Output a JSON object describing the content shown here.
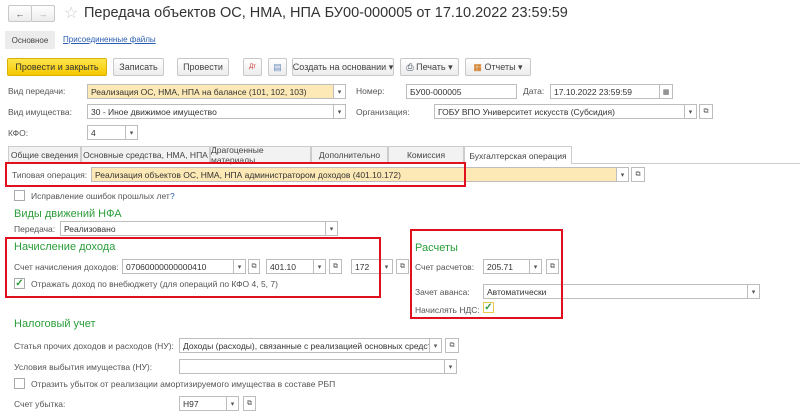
{
  "window": {
    "title": "Передача объектов ОС, НМА, НПА БУ00-000005 от 17.10.2022 23:59:59"
  },
  "nav": {
    "tabs": [
      {
        "label": "Основное"
      },
      {
        "label": "Присоединенные файлы"
      }
    ]
  },
  "toolbar": {
    "post_close": "Провести и закрыть",
    "save": "Записать",
    "post": "Провести",
    "create_based": "Создать на основании",
    "print": "Печать",
    "reports": "Отчеты"
  },
  "header": {
    "transfer_type": {
      "label": "Вид передачи:",
      "value": "Реализация ОС, НМА, НПА на балансе (101, 102, 103)"
    },
    "number": {
      "label": "Номер:",
      "value": "БУ00-000005"
    },
    "date": {
      "label": "Дата:",
      "value": "17.10.2022 23:59:59"
    },
    "property_type": {
      "label": "Вид имущества:",
      "value": "30 - Иное движимое имущество"
    },
    "organization": {
      "label": "Организация:",
      "value": "ГОБУ ВПО Университет искусств (Субсидия)"
    },
    "kfo": {
      "label": "КФО:",
      "value": "4"
    }
  },
  "tabs": [
    {
      "label": "Общие сведения"
    },
    {
      "label": "Основные средства, НМА, НПА"
    },
    {
      "label": "Драгоценные материалы"
    },
    {
      "label": "Дополнительно"
    },
    {
      "label": "Комиссия"
    },
    {
      "label": "Бухгалтерская операция",
      "active": true
    }
  ],
  "main": {
    "typical_op": {
      "label": "Типовая операция:",
      "value": "Реализация объектов ОС, НМА, НПА администратором доходов (401.10.172)"
    },
    "fix_errors": {
      "label": "Исправление ошибок прошлых лет",
      "checked": false,
      "help": "?"
    },
    "nfa": {
      "heading": "Виды движений НФА",
      "transfer_label": "Передача:",
      "transfer_value": "Реализовано"
    },
    "income": {
      "heading": "Начисление дохода",
      "account_label": "Счет начисления доходов:",
      "account": "07060000000000410",
      "kosgu1": "401.10",
      "kosgu2": "172",
      "offbudget_label": "Отражать доход по внебюджету (для операций по КФО 4, 5, 7)",
      "offbudget_checked": true
    },
    "settlements": {
      "heading": "Расчеты",
      "account_label": "Счет расчетов:",
      "account": "205.71",
      "advance_label": "Зачет аванса:",
      "advance": "Автоматически",
      "vat_label": "Начислять НДС:",
      "vat_checked": true
    },
    "tax": {
      "heading": "Налоговый учет",
      "item_label": "Статья прочих доходов и расходов (НУ):",
      "item": "Доходы (расходы), связанные с реализацией основных средств",
      "conditions_label": "Условия выбытия имущества (НУ):",
      "conditions": "",
      "loss_label": "Отразить убыток от реализации амортизируемого имущества в составе РБП",
      "loss_checked": false,
      "loss_account_label": "Счет убытка:",
      "loss_account": "Н97"
    }
  },
  "colors": {
    "accent_green": "#2a9d3a",
    "highlight_red": "#e0101c",
    "yellow": "#f5c800"
  }
}
